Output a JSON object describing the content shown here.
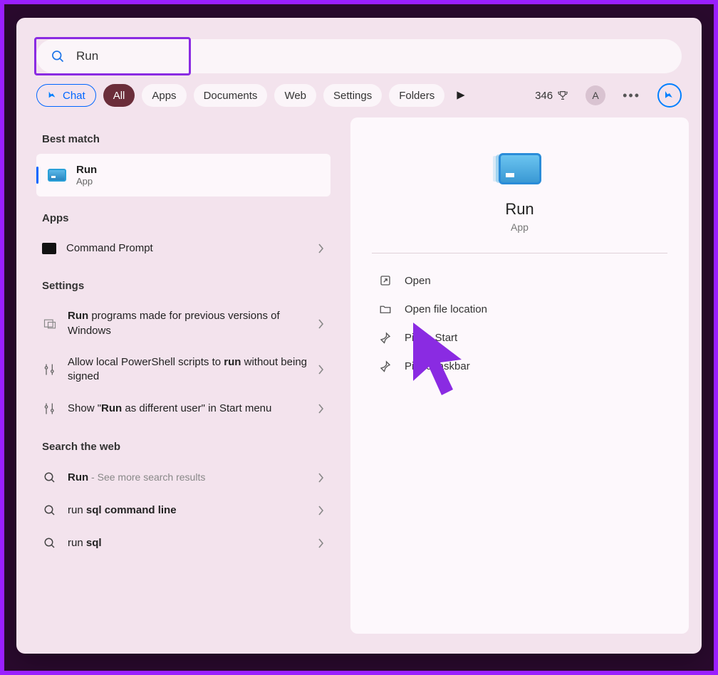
{
  "search": {
    "value": "Run"
  },
  "tabs": {
    "chat": "Chat",
    "all": "All",
    "apps": "Apps",
    "documents": "Documents",
    "web": "Web",
    "settings_tab": "Settings",
    "folders": "Folders"
  },
  "header": {
    "points": "346",
    "avatar_letter": "A"
  },
  "sections": {
    "best_match": "Best match",
    "apps": "Apps",
    "settings": "Settings",
    "search_web": "Search the web"
  },
  "best_match": {
    "title": "Run",
    "subtitle": "App"
  },
  "apps_list": [
    {
      "label": "Command Prompt"
    }
  ],
  "settings_list": [
    {
      "pre": "",
      "bold": "Run",
      "post": " programs made for previous versions of Windows"
    },
    {
      "pre": "Allow local PowerShell scripts to ",
      "bold": "run",
      "post": " without being signed"
    },
    {
      "pre": "Show \"",
      "bold": "Run",
      "post": " as different user\" in Start menu"
    }
  ],
  "web_list": [
    {
      "bold": "Run",
      "post": "",
      "muted": " - See more search results"
    },
    {
      "pre": "run ",
      "bold": "sql command line"
    },
    {
      "pre": "run ",
      "bold": "sql"
    }
  ],
  "detail": {
    "title": "Run",
    "subtitle": "App",
    "actions": {
      "open": "Open",
      "open_location": "Open file location",
      "pin_start": "Pin to Start",
      "pin_taskbar": "Pin to taskbar"
    }
  }
}
